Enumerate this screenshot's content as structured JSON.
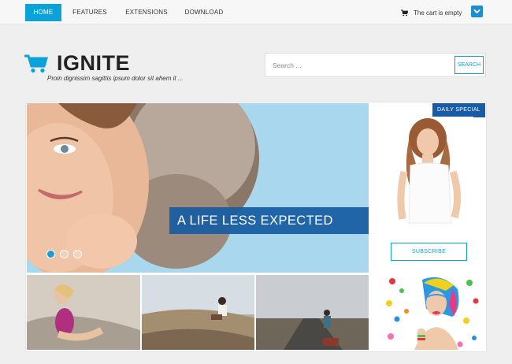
{
  "nav": {
    "items": [
      {
        "label": "HOME",
        "active": true
      },
      {
        "label": "FEATURES",
        "active": false
      },
      {
        "label": "EXTENSIONS",
        "active": false
      },
      {
        "label": "DOWNLOAD",
        "active": false
      }
    ]
  },
  "cart": {
    "icon": "cart-icon",
    "text": "The cart is empty",
    "toggle_icon": "chevron-down-icon"
  },
  "header": {
    "logo_icon": "shopping-cart-icon",
    "title": "IGNITE",
    "tagline": "Proin dignissim sagittis ipsum dolor sit ahem it ..."
  },
  "search": {
    "placeholder": "Search ...",
    "button_label": "SEARCH"
  },
  "slider": {
    "caption": "A LIFE LESS EXPECTED",
    "slide_count": 3,
    "active_slide": 1
  },
  "sidebar": {
    "badge": "DAILY SPECIAL",
    "subscribe_label": "SUBSCRIBE"
  },
  "colors": {
    "accent": "#0aa2d9",
    "brand_blue": "#165ba3",
    "background": "#efefef"
  }
}
